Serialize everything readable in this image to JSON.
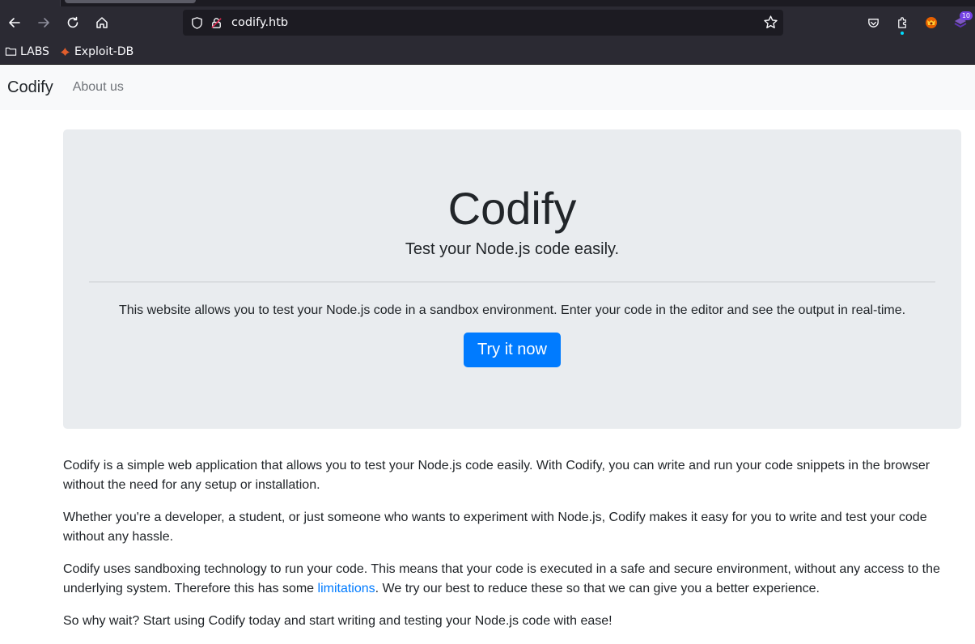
{
  "browser": {
    "url": "codify.htb",
    "extension_badge": "10",
    "bookmarks": [
      {
        "label": "LABS"
      },
      {
        "label": "Exploit-DB"
      }
    ]
  },
  "site": {
    "brand": "Codify",
    "nav_about": "About us"
  },
  "hero": {
    "title": "Codify",
    "lead": "Test your Node.js code easily.",
    "text": "This website allows you to test your Node.js code in a sandbox environment. Enter your code in the editor and see the output in real-time.",
    "button": "Try it now"
  },
  "content": {
    "p1": "Codify is a simple web application that allows you to test your Node.js code easily. With Codify, you can write and run your code snippets in the browser without the need for any setup or installation.",
    "p2": "Whether you're a developer, a student, or just someone who wants to experiment with Node.js, Codify makes it easy for you to write and test your code without any hassle.",
    "p3_before": "Codify uses sandboxing technology to run your code. This means that your code is executed in a safe and secure environment, without any access to the underlying system. Therefore this has some ",
    "p3_link": "limitations",
    "p3_after": ". We try our best to reduce these so that we can give you a better experience.",
    "p4": "So why wait? Start using Codify today and start writing and testing your Node.js code with ease!"
  },
  "colors": {
    "primary": "#007bff",
    "jumbotron_bg": "#e9ecef",
    "navbar_bg": "#f8f9fa",
    "chrome_bg": "#2b2a33"
  }
}
